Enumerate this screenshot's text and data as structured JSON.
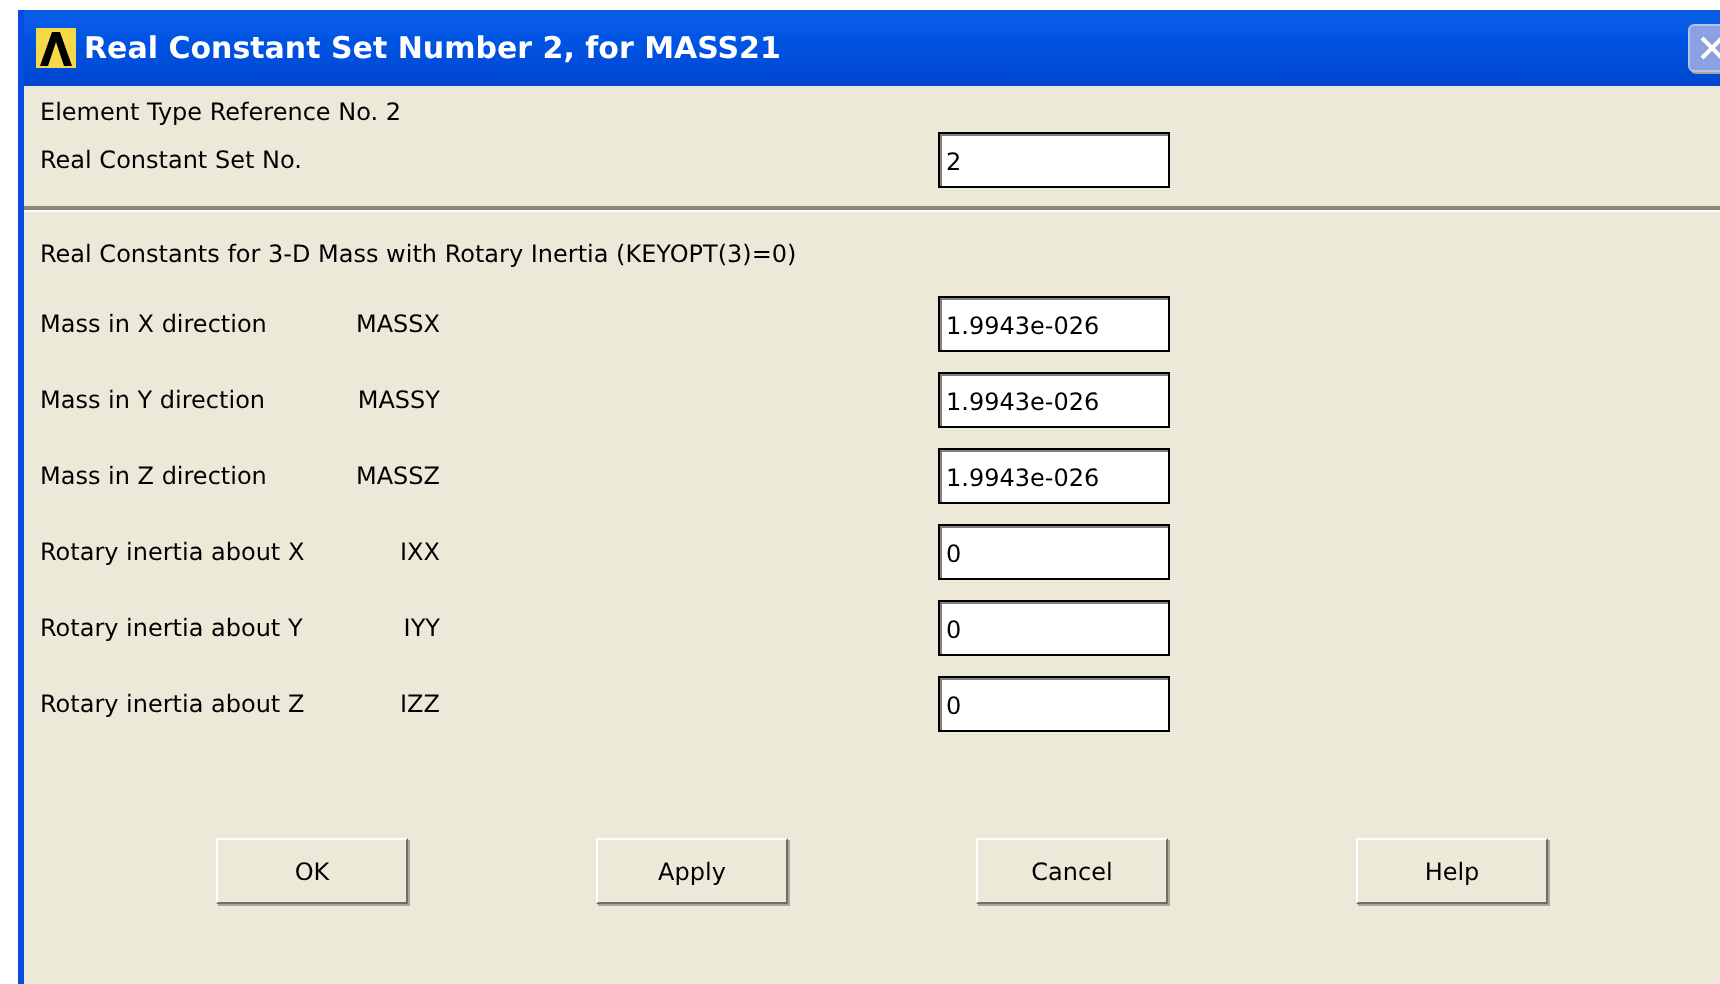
{
  "window": {
    "title": "Real Constant Set Number 2, for MASS21"
  },
  "header": {
    "element_type": "Element Type Reference No. 2",
    "set_label": "Real Constant Set No.",
    "set_value": "2"
  },
  "section_title": "Real Constants for 3-D Mass with Rotary Inertia (KEYOPT(3)=0)",
  "constants": [
    {
      "label": "Mass in X direction",
      "symbol": "MASSX",
      "value": "1.9943e-026"
    },
    {
      "label": "Mass in Y direction",
      "symbol": "MASSY",
      "value": "1.9943e-026"
    },
    {
      "label": "Mass in Z direction",
      "symbol": "MASSZ",
      "value": "1.9943e-026"
    },
    {
      "label": "Rotary inertia about X",
      "symbol": "IXX",
      "value": "0"
    },
    {
      "label": "Rotary inertia about Y",
      "symbol": "IYY",
      "value": "0"
    },
    {
      "label": "Rotary inertia about Z",
      "symbol": "IZZ",
      "value": "0"
    }
  ],
  "buttons": [
    "OK",
    "Apply",
    "Cancel",
    "Help"
  ]
}
